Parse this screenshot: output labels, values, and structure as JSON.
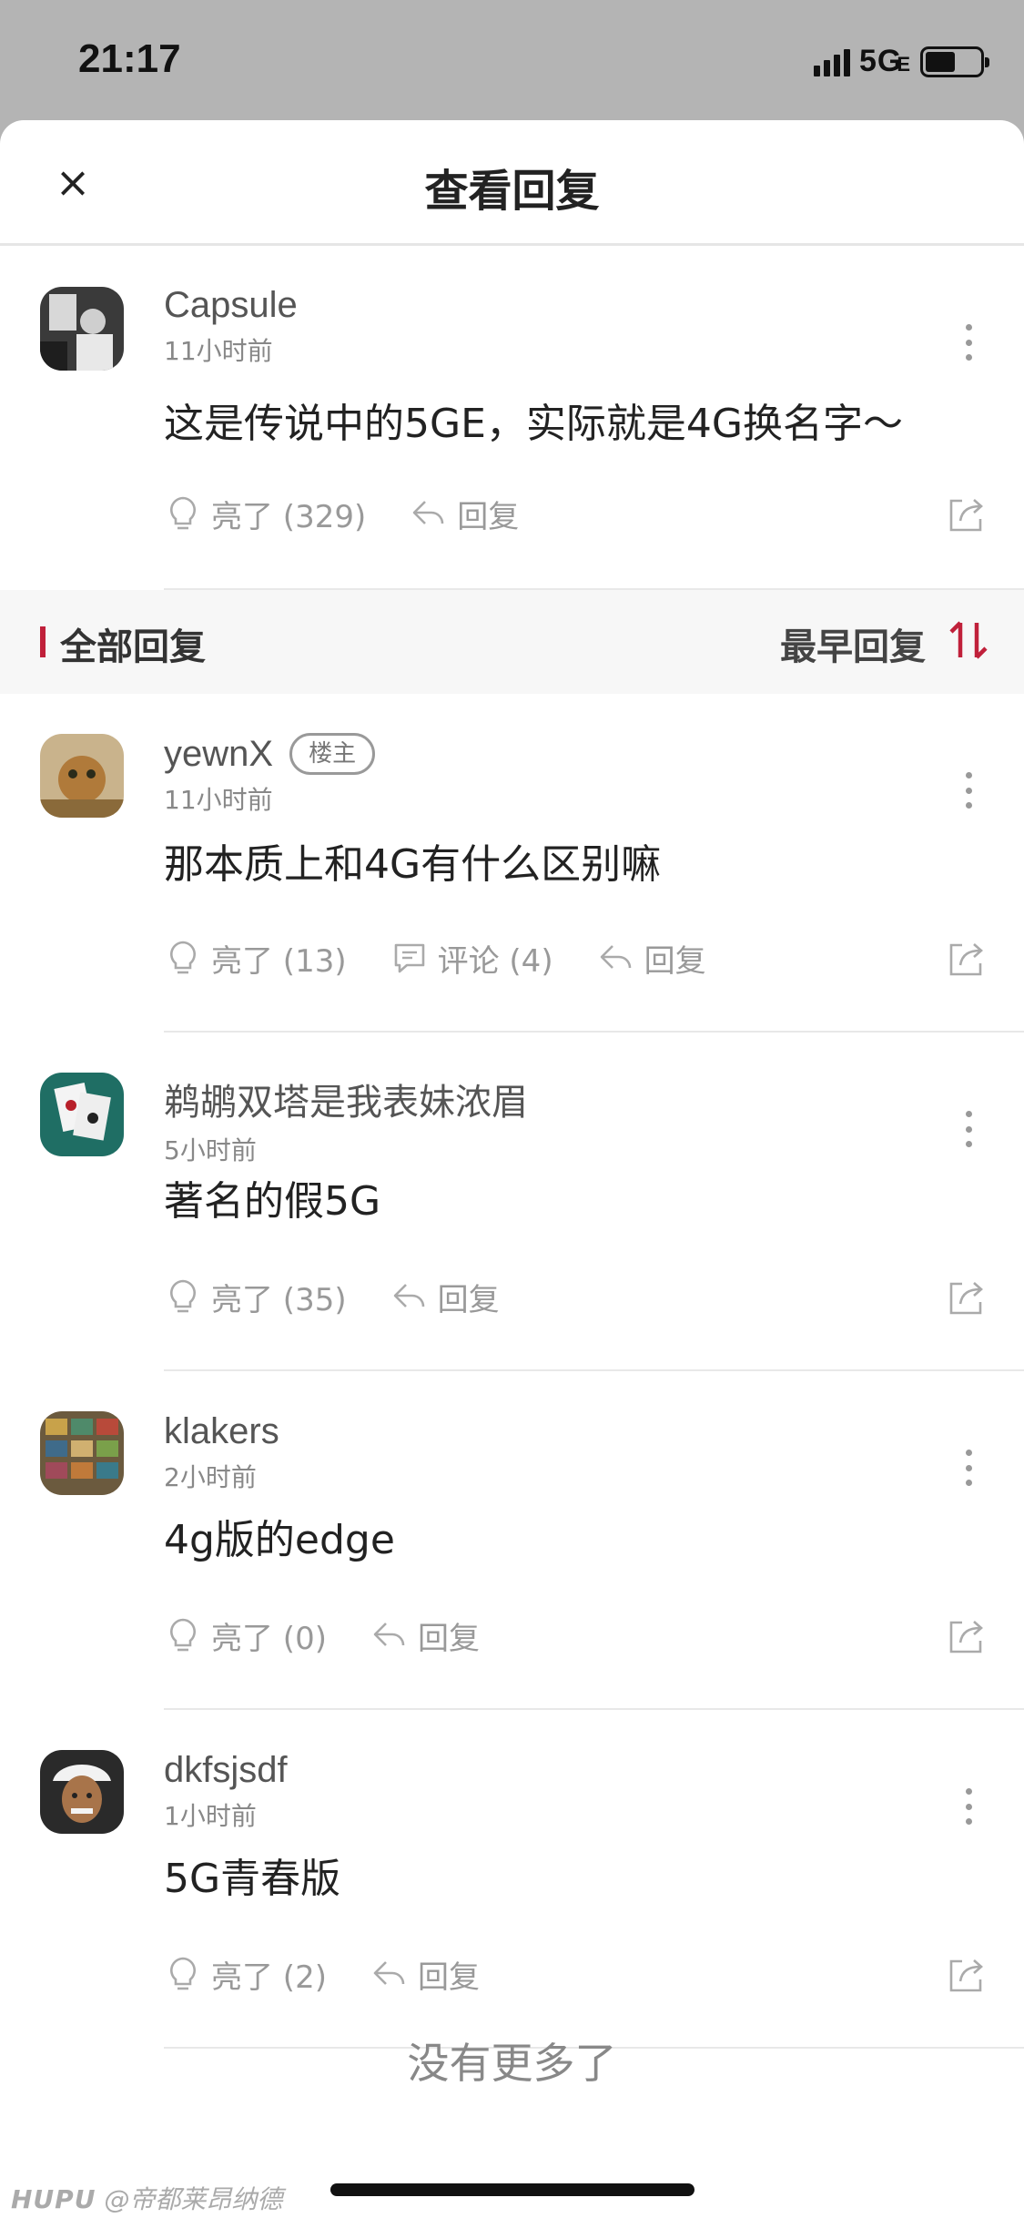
{
  "status_bar": {
    "time": "21:17",
    "network": "5G",
    "network_sub": "E"
  },
  "header": {
    "close_label": "×",
    "title": "查看回复"
  },
  "main_comment": {
    "username": "Capsule",
    "timestamp": "11小时前",
    "content": "这是传说中的5GE，实际就是4G换名字～",
    "likes_label": "亮了 (329)",
    "reply_label": "回复"
  },
  "section": {
    "title": "全部回复",
    "sort_label": "最早回复"
  },
  "replies": [
    {
      "username": "yewnX",
      "badge": "楼主",
      "timestamp": "11小时前",
      "content": "那本质上和4G有什么区别嘛",
      "likes_label": "亮了 (13)",
      "comments_label": "评论 (4)",
      "reply_label": "回复"
    },
    {
      "username": "鹈鹕双塔是我表妹浓眉",
      "timestamp": "5小时前",
      "content": "著名的假5G",
      "likes_label": "亮了 (35)",
      "reply_label": "回复"
    },
    {
      "username": "klakers",
      "timestamp": "2小时前",
      "content": "4g版的edge",
      "likes_label": "亮了 (0)",
      "reply_label": "回复"
    },
    {
      "username": "dkfsjsdf",
      "timestamp": "1小时前",
      "content": "5G青春版",
      "likes_label": "亮了 (2)",
      "reply_label": "回复"
    }
  ],
  "footer": {
    "no_more": "没有更多了",
    "watermark_brand": "HUPU",
    "watermark_user": "@帝都莱昂纳德"
  },
  "colors": {
    "accent": "#c0203a",
    "status_bg": "#b4b4b4"
  }
}
